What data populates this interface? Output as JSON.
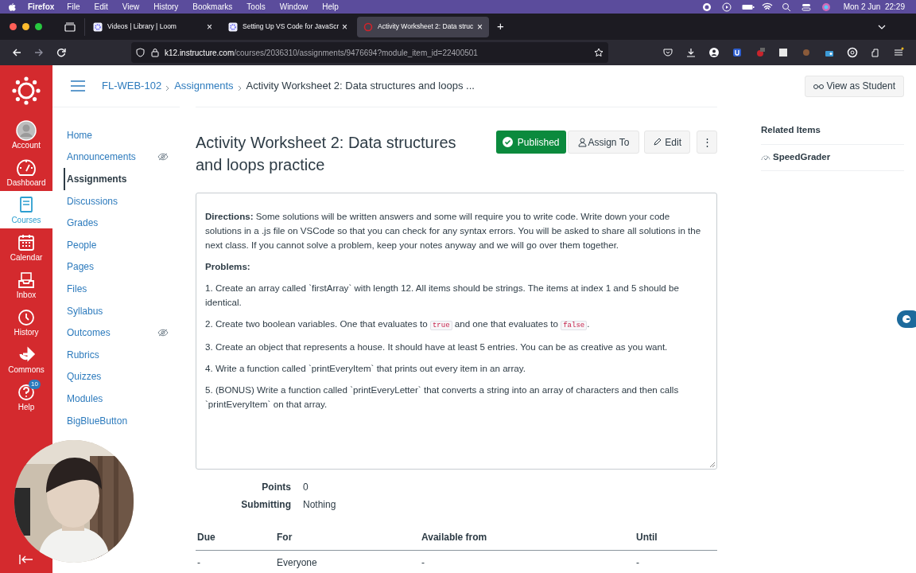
{
  "menu_bar": {
    "app": "Firefox",
    "items": [
      "File",
      "Edit",
      "View",
      "History",
      "Bookmarks",
      "Tools",
      "Window",
      "Help"
    ],
    "clock": "Mon 2 Jun  22:29"
  },
  "browser_tabs": [
    {
      "title": "Videos | Library | Loom",
      "close": "×",
      "selected": false
    },
    {
      "title": "Setting Up VS Code for JavaScr",
      "close": "×",
      "selected": false
    },
    {
      "title": "Activity Worksheet 2: Data struc",
      "close": "×",
      "selected": true
    }
  ],
  "new_tab": "+",
  "address_bar": {
    "host": "k12.instructure.com",
    "path": "/courses/2036310/assignments/9476694?module_item_id=22400501"
  },
  "global_nav": [
    {
      "label": "Account",
      "selected": false
    },
    {
      "label": "Dashboard",
      "selected": false
    },
    {
      "label": "Courses",
      "selected": true
    },
    {
      "label": "Calendar",
      "selected": false
    },
    {
      "label": "Inbox",
      "selected": false
    },
    {
      "label": "History",
      "selected": false
    },
    {
      "label": "Commons",
      "selected": false
    },
    {
      "label": "Help",
      "selected": false,
      "badge": "10"
    }
  ],
  "breadcrumbs": [
    "FL-WEB-102",
    "Assignments",
    "Activity Worksheet 2: Data structures and loops ..."
  ],
  "view_as_student": "View as Student",
  "course_nav": [
    {
      "label": "Home",
      "selected": false,
      "hidden": false
    },
    {
      "label": "Announcements",
      "selected": false,
      "hidden": true
    },
    {
      "label": "Assignments",
      "selected": true,
      "hidden": false
    },
    {
      "label": "Discussions",
      "selected": false,
      "hidden": false
    },
    {
      "label": "Grades",
      "selected": false,
      "hidden": false
    },
    {
      "label": "People",
      "selected": false,
      "hidden": false
    },
    {
      "label": "Pages",
      "selected": false,
      "hidden": false
    },
    {
      "label": "Files",
      "selected": false,
      "hidden": false
    },
    {
      "label": "Syllabus",
      "selected": false,
      "hidden": false
    },
    {
      "label": "Outcomes",
      "selected": false,
      "hidden": true
    },
    {
      "label": "Rubrics",
      "selected": false,
      "hidden": false
    },
    {
      "label": "Quizzes",
      "selected": false,
      "hidden": false
    },
    {
      "label": "Modules",
      "selected": false,
      "hidden": false
    },
    {
      "label": "BigBlueButton",
      "selected": false,
      "hidden": false
    }
  ],
  "assignment": {
    "title": "Activity Worksheet 2: Data structures and loops practice",
    "published_button": "Published",
    "assign_button": "Assign To",
    "edit_button": "Edit",
    "more_button": "⋮",
    "directions": "**Directions:** Some solutions will be written answers and some will require you to write code. Write down your code solutions in a .js file on VSCode so that you can check for any syntax errors. You will be asked to share all solutions in the next class. If you cannot solve a problem, keep your notes anyway and we will go over them together.",
    "problems_heading": "Problems:",
    "problems": [
      [
        {
          "kind": "text",
          "text": "1. Create an array called `firstArray` with length 12. All items should be strings. The items at index 1 and 5 should be identical."
        }
      ],
      [
        {
          "kind": "text",
          "text": "2. Create two boolean variables. One that evaluates to "
        },
        {
          "kind": "code",
          "text": "true"
        },
        {
          "kind": "text",
          "text": " and one that evaluates to "
        },
        {
          "kind": "code",
          "text": "false"
        },
        {
          "kind": "text",
          "text": "."
        }
      ],
      [
        {
          "kind": "text",
          "text": "3. Create an object that represents a house. It should have at least 5 entries. You can be as creative as you want."
        }
      ],
      [
        {
          "kind": "text",
          "text": "4. Write a function called `printEveryItem` that prints out every item in an array."
        }
      ],
      [
        {
          "kind": "text",
          "text": "5. (BONUS) Write a function called `printEveryLetter` that converts a string into an array of characters and then calls `printEveryItem` on that array."
        }
      ]
    ],
    "details": [
      {
        "label": "Points",
        "value": "0"
      },
      {
        "label": "Submitting",
        "value": "Nothing"
      }
    ],
    "dates_table": {
      "columns": [
        "Due",
        "For",
        "Available from",
        "Until"
      ],
      "rows": [
        [
          "-",
          "Everyone",
          "-",
          "-"
        ]
      ]
    }
  },
  "related_items": {
    "heading": "Related Items",
    "items": [
      "SpeedGrader"
    ]
  },
  "webcam": {
    "kind": "picture"
  }
}
